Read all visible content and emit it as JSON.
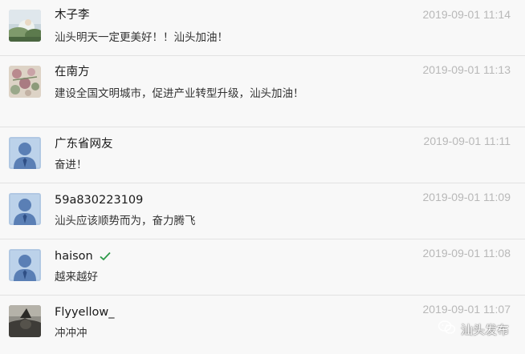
{
  "comments": [
    {
      "author": "木子李",
      "content": "汕头明天一定更美好！！汕头加油！",
      "time": "2019-09-01 11:14",
      "avatar": "photo-landscape-icon"
    },
    {
      "author": "在南方",
      "content": "建设全国文明城市，促进产业转型升级，汕头加油！",
      "time": "2019-09-01 11:13",
      "avatar": "photo-flowers-icon"
    },
    {
      "author": "广东省网友",
      "content": "奋进！",
      "time": "2019-09-01 11:11",
      "avatar": "default-user-icon"
    },
    {
      "author": "59a830223109",
      "content": "汕头应该顺势而为，奋力腾飞",
      "time": "2019-09-01 11:09",
      "avatar": "default-user-icon"
    },
    {
      "author": "haison",
      "content": "越来越好",
      "time": "2019-09-01 11:08",
      "avatar": "default-user-icon",
      "verified": true
    },
    {
      "author": "Flyyellow_",
      "content": "冲冲冲",
      "time": "2019-09-01 11:07",
      "avatar": "photo-dark-icon"
    }
  ],
  "watermark": {
    "text": "汕头发布",
    "icon": "wechat-icon"
  },
  "colors": {
    "background": "#f8f8f8",
    "time": "#b8b8b8",
    "verified": "#2e9a4a",
    "divider": "#e2e2e2"
  }
}
